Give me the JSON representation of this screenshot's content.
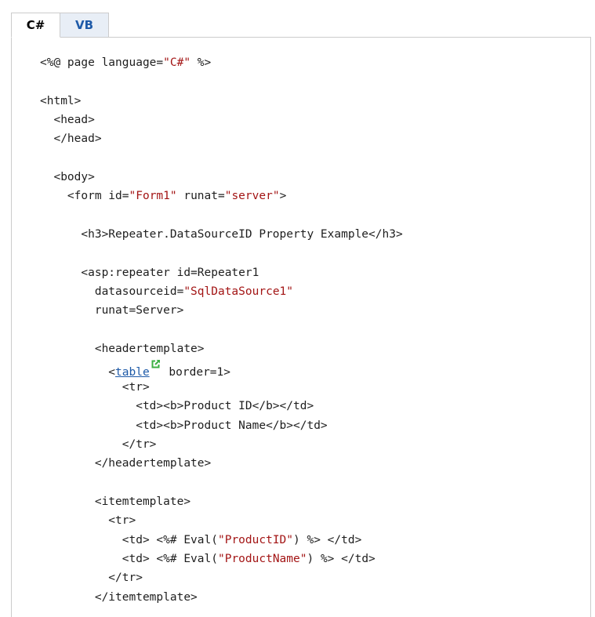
{
  "tabs": [
    {
      "label": "C#",
      "active": true
    },
    {
      "label": "VB",
      "active": false
    }
  ],
  "colors": {
    "string": "#a31515",
    "link": "#1e5aa8",
    "external_icon": "#3cb043",
    "tab_inactive_bg": "#e8eef6"
  },
  "icons": {
    "external_link": "external-link-icon"
  },
  "code": [
    [
      {
        "t": "<%@ page language="
      },
      {
        "t": "\"C#\"",
        "k": "str"
      },
      {
        "t": " %>"
      }
    ],
    [],
    [
      {
        "t": "<html>"
      }
    ],
    [
      {
        "t": "  <head>"
      }
    ],
    [
      {
        "t": "  </head>"
      }
    ],
    [],
    [
      {
        "t": "  <body>"
      }
    ],
    [
      {
        "t": "    <form id="
      },
      {
        "t": "\"Form1\"",
        "k": "str"
      },
      {
        "t": " runat="
      },
      {
        "t": "\"server\"",
        "k": "str"
      },
      {
        "t": ">"
      }
    ],
    [],
    [
      {
        "t": "      <h3>Repeater.DataSourceID Property Example</h3>"
      }
    ],
    [],
    [
      {
        "t": "      <asp:repeater id=Repeater1"
      }
    ],
    [
      {
        "t": "        datasourceid="
      },
      {
        "t": "\"SqlDataSource1\"",
        "k": "str"
      }
    ],
    [
      {
        "t": "        runat=Server>"
      }
    ],
    [],
    [
      {
        "t": "        <headertemplate>"
      }
    ],
    [
      {
        "t": "          <"
      },
      {
        "t": "table",
        "k": "link"
      },
      {
        "k": "ext"
      },
      {
        "t": " border=1>"
      }
    ],
    [
      {
        "t": "            <tr>"
      }
    ],
    [
      {
        "t": "              <td><b>Product ID</b></td>"
      }
    ],
    [
      {
        "t": "              <td><b>Product Name</b></td>"
      }
    ],
    [
      {
        "t": "            </tr>"
      }
    ],
    [
      {
        "t": "        </headertemplate>"
      }
    ],
    [],
    [
      {
        "t": "        <itemtemplate>"
      }
    ],
    [
      {
        "t": "          <tr>"
      }
    ],
    [
      {
        "t": "            <td> <%# Eval("
      },
      {
        "t": "\"ProductID\"",
        "k": "str"
      },
      {
        "t": ") %> </td>"
      }
    ],
    [
      {
        "t": "            <td> <%# Eval("
      },
      {
        "t": "\"ProductName\"",
        "k": "str"
      },
      {
        "t": ") %> </td>"
      }
    ],
    [
      {
        "t": "          </tr>"
      }
    ],
    [
      {
        "t": "        </itemtemplate>"
      }
    ]
  ]
}
